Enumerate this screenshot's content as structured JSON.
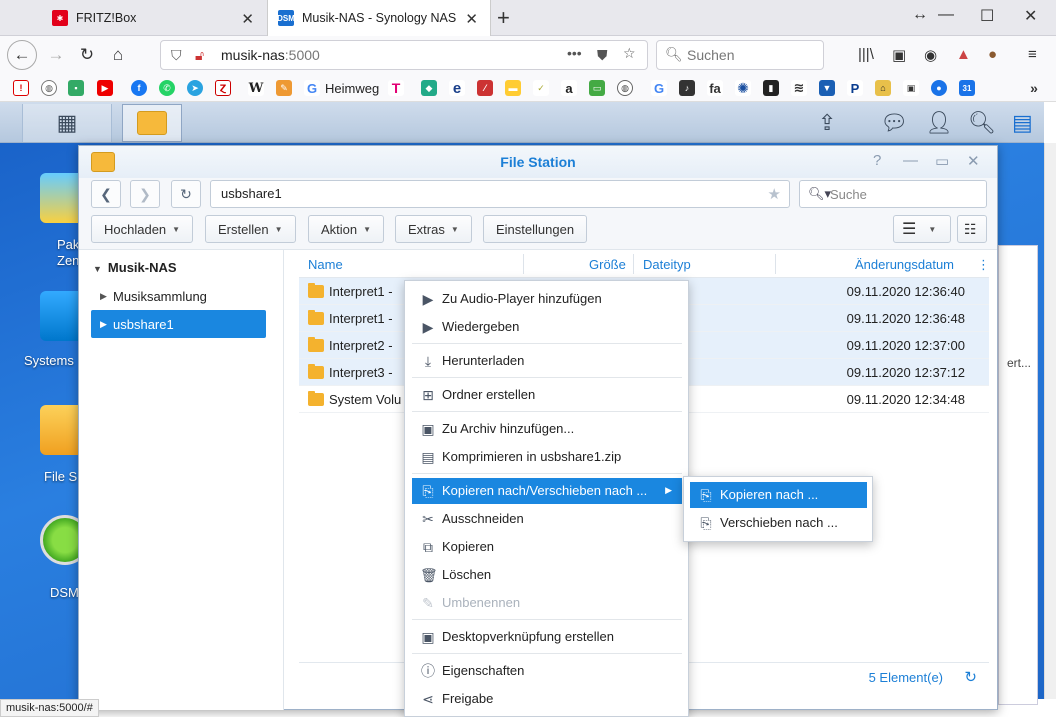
{
  "browser": {
    "tabs": [
      {
        "title": "FRITZ!Box",
        "active": false
      },
      {
        "title": "Musik-NAS - Synology NAS",
        "active": true
      }
    ],
    "url_host": "musik-nas",
    "url_port": ":5000",
    "search_placeholder": "Suchen",
    "bookmark_label": "Heimweg",
    "status_url": "musik-nas:5000/#"
  },
  "desktop": {
    "icons": [
      {
        "label": "Pak\nZen"
      },
      {
        "label": "Systems"
      },
      {
        "label": "File S"
      },
      {
        "label": "DSM"
      }
    ]
  },
  "filestation": {
    "title": "File Station",
    "path": "usbshare1",
    "search_placeholder": "Suche",
    "toolbar": {
      "upload": "Hochladen",
      "create": "Erstellen",
      "action": "Aktion",
      "extras": "Extras",
      "settings": "Einstellungen"
    },
    "tree": {
      "root": "Musik-NAS",
      "items": [
        {
          "label": "Musiksammlung",
          "selected": false
        },
        {
          "label": "usbshare1",
          "selected": true
        }
      ]
    },
    "columns": {
      "name": "Name",
      "size": "Größe",
      "type": "Dateityp",
      "modified": "Änderungsdatum"
    },
    "rows": [
      {
        "name": "Interpret1 -",
        "date": "09.11.2020 12:36:40",
        "selected": true
      },
      {
        "name": "Interpret1 -",
        "date": "09.11.2020 12:36:48",
        "selected": true
      },
      {
        "name": "Interpret2 -",
        "date": "09.11.2020 12:37:00",
        "selected": true
      },
      {
        "name": "Interpret3 -",
        "date": "09.11.2020 12:37:12",
        "selected": true
      },
      {
        "name": "System Volu",
        "date": "09.11.2020 12:34:48",
        "selected": false
      }
    ],
    "count": "5 Element(e)"
  },
  "context_menu": {
    "items": [
      {
        "label": "Zu Audio-Player hinzufügen",
        "icon": "play-icon"
      },
      {
        "label": "Wiedergeben",
        "icon": "play-icon"
      },
      {
        "label": "Herunterladen",
        "icon": "download-icon"
      },
      {
        "label": "Ordner erstellen",
        "icon": "new-folder-icon"
      },
      {
        "label": "Zu Archiv hinzufügen...",
        "icon": "archive-icon"
      },
      {
        "label": "Komprimieren in usbshare1.zip",
        "icon": "compress-icon"
      },
      {
        "label": "Kopieren nach/Verschieben nach ...",
        "icon": "copy-move-icon"
      },
      {
        "label": "Ausschneiden",
        "icon": "scissors-icon"
      },
      {
        "label": "Kopieren",
        "icon": "copy-icon"
      },
      {
        "label": "Löschen",
        "icon": "trash-icon"
      },
      {
        "label": "Umbenennen",
        "icon": "pencil-icon"
      },
      {
        "label": "Desktopverknüpfung erstellen",
        "icon": "shortcut-icon"
      },
      {
        "label": "Eigenschaften",
        "icon": "info-icon"
      },
      {
        "label": "Freigabe",
        "icon": "share-icon"
      }
    ],
    "submenu": [
      {
        "label": "Kopieren nach ..."
      },
      {
        "label": "Verschieben nach ..."
      }
    ]
  },
  "background_window": {
    "text": "ert..."
  },
  "colors": {
    "accent": "#1a87e0",
    "title": "#1c7fd6",
    "folder": "#f4b22e"
  }
}
